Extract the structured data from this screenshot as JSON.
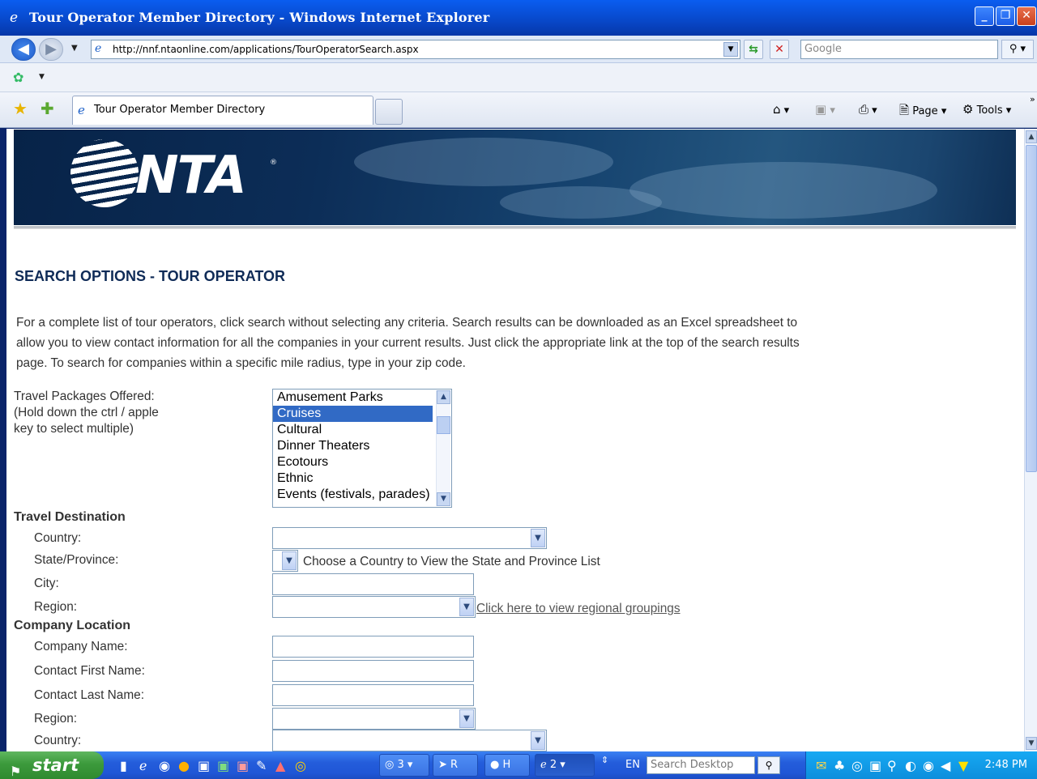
{
  "window": {
    "title": "Tour Operator Member Directory - Windows Internet Explorer",
    "url": "http://nnf.ntaonline.com/applications/TourOperatorSearch.aspx",
    "search_placeholder": "Google"
  },
  "tab": {
    "label": "Tour Operator Member Directory"
  },
  "commands": {
    "page": "Page",
    "tools": "Tools"
  },
  "page": {
    "logo": "NTA",
    "heading": "SEARCH OPTIONS - TOUR OPERATOR",
    "intro": "For a complete list of tour operators, click search without selecting any criteria. Search results can be downloaded as an Excel spreadsheet to allow you to view contact information for all the companies in your current results. Just click the appropriate link at the top of the search results page. To search for companies within a specific mile radius, type in your zip code.",
    "packages_label_1": "Travel Packages Offered:",
    "packages_label_2": "(Hold down the ctrl / apple",
    "packages_label_3": "key to select multiple)",
    "packages": [
      "Amusement Parks",
      "Cruises",
      "Cultural",
      "Dinner Theaters",
      "Ecotours",
      "Ethnic",
      "Events (festivals, parades)"
    ],
    "packages_selected": "Cruises",
    "destination": {
      "title": "Travel Destination",
      "country": "Country:",
      "state": "State/Province:",
      "state_hint": "Choose a Country to View the State and Province List",
      "city": "City:",
      "region": "Region:",
      "region_link": "Click here to view regional groupings"
    },
    "company": {
      "title": "Company Location",
      "name": "Company Name:",
      "first": "Contact First Name:",
      "last": "Contact Last Name:",
      "region": "Region:",
      "country": "Country:"
    }
  },
  "taskbar": {
    "start": "start",
    "groups": [
      "3",
      "R",
      "H",
      "2"
    ],
    "lang": "EN",
    "desktop_search": "Search Desktop",
    "clock": "2:48 PM"
  }
}
